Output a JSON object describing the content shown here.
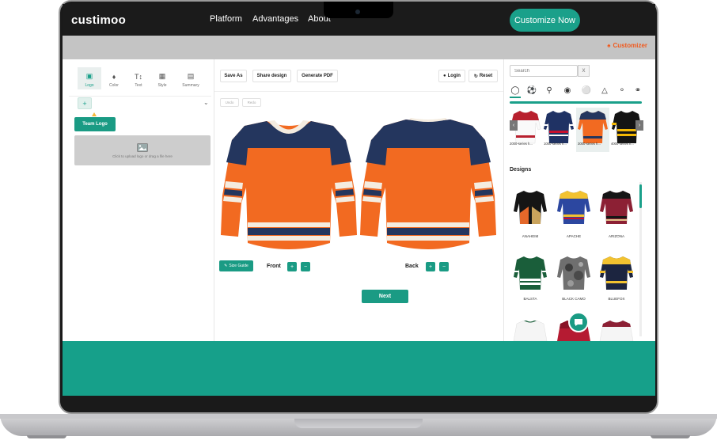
{
  "nav": {
    "brand": "custimoo",
    "links": [
      "Platform",
      "Advantages",
      "About"
    ],
    "cta": "Customize Now"
  },
  "subbar": {
    "customizer": "Customizer"
  },
  "left_panel": {
    "tabs": [
      {
        "label": "Logo",
        "icon": "image-icon"
      },
      {
        "label": "Color",
        "icon": "paint-bucket-icon"
      },
      {
        "label": "Text",
        "icon": "text-icon"
      },
      {
        "label": "Style",
        "icon": "style-icon"
      },
      {
        "label": "Summary",
        "icon": "document-icon"
      }
    ],
    "add": "+",
    "team_logo": "Team Logo",
    "upload_hint": "Click to upload logo or drag a file here"
  },
  "toolbar": {
    "save_as": "Save As",
    "share": "Share design",
    "pdf": "Generate PDF",
    "login": "Login",
    "reset": "Reset",
    "undo": "Undo",
    "redo": "Redo"
  },
  "canvas": {
    "size_guide": "Size Guide",
    "front": "Front",
    "back": "Back",
    "next": "Next",
    "colors": {
      "orange": "#f26a21",
      "navy": "#24365e",
      "cream": "#f4ece0"
    }
  },
  "right_panel": {
    "search_placeholder": "Search",
    "search_clear": "X",
    "sports": [
      "hockey-helmet-icon",
      "soccer-ball-icon",
      "lacrosse-stick-icon",
      "football-helmet-icon",
      "bicycle-icon",
      "tshirt-icon",
      "rugby-ball-icon",
      "volleyball-icon"
    ],
    "series": [
      "2000-series h...",
      "1000-series h...",
      "3000-series h...",
      "4000-series h..."
    ],
    "designs_title": "Designs",
    "designs": [
      "ANAHEIM",
      "APACHE",
      "ARIZONA",
      "BALSTA",
      "BLACK CAMO",
      "BLUEFOX"
    ]
  }
}
